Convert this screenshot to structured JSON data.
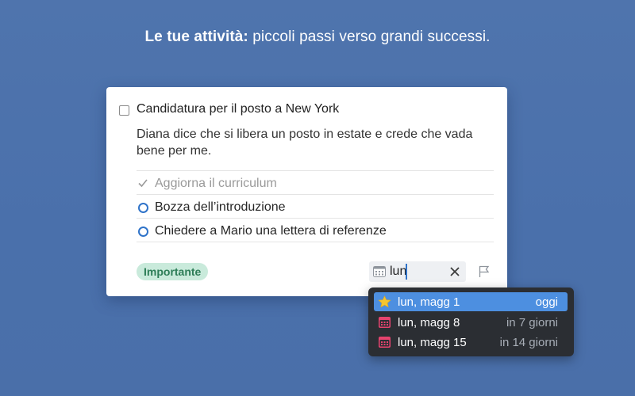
{
  "headline": {
    "bold": "Le tue attività:",
    "rest": " piccoli passi verso grandi successi."
  },
  "task": {
    "title": "Candidatura per il posto a New York",
    "notes": "Diana dice che si libera un posto in estate e crede che vada bene per me.",
    "checklist": [
      {
        "label": "Aggiorna il curriculum",
        "done": true
      },
      {
        "label": "Bozza dell’introduzione",
        "done": false
      },
      {
        "label": "Chiedere a Mario una lettera di referenze",
        "done": false
      }
    ],
    "tag": "Importante",
    "date_input": "lun"
  },
  "suggestions": [
    {
      "label": "lun, magg 1",
      "relative": "oggi",
      "icon": "star-icon",
      "selected": true
    },
    {
      "label": "lun, magg 8",
      "relative": "in 7 giorni",
      "icon": "calendar-icon",
      "selected": false
    },
    {
      "label": "lun, magg 15",
      "relative": "in 14 giorni",
      "icon": "calendar-icon",
      "selected": false
    }
  ],
  "colors": {
    "background": "#4a70ab",
    "tag_bg": "#c9eadb",
    "tag_text": "#2d7d57",
    "accent": "#2f73c9",
    "selection": "#4d8fe0",
    "calendar_icon": "#e5436e"
  }
}
